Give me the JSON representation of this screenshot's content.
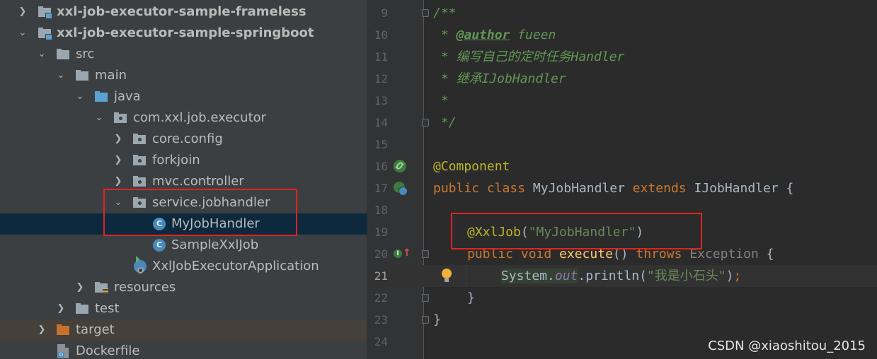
{
  "tree": {
    "items": [
      {
        "label": "xxl-job-executor-sample-frameless",
        "expanded": false
      },
      {
        "label": "xxl-job-executor-sample-springboot",
        "expanded": true
      },
      {
        "label": "src",
        "expanded": true
      },
      {
        "label": "main",
        "expanded": true
      },
      {
        "label": "java",
        "expanded": true
      },
      {
        "label": "com.xxl.job.executor",
        "expanded": true
      },
      {
        "label": "core.config",
        "expanded": false
      },
      {
        "label": "forkjoin",
        "expanded": false
      },
      {
        "label": "mvc.controller",
        "expanded": false
      },
      {
        "label": "service.jobhandler",
        "expanded": true
      },
      {
        "label": "MyJobHandler",
        "selected": true
      },
      {
        "label": "SampleXxlJob"
      },
      {
        "label": "XxlJobExecutorApplication"
      },
      {
        "label": "resources",
        "expanded": false
      },
      {
        "label": "test",
        "expanded": false
      },
      {
        "label": "target",
        "expanded": false
      },
      {
        "label": "Dockerfile"
      }
    ],
    "class_icon_letter": "C",
    "docker_icon_letter": "D"
  },
  "editor": {
    "line_numbers": [
      "9",
      "10",
      "11",
      "12",
      "13",
      "14",
      "15",
      "16",
      "17",
      "18",
      "19",
      "20",
      "21",
      "22",
      "23",
      "24"
    ],
    "current_line": "21",
    "code": {
      "l9": "/**",
      "l10_star": " * ",
      "l10_tag": "@author",
      "l10_rest": " fueen",
      "l11": " * 编写自己的定时任务Handler",
      "l12": " * 继承IJobHandler",
      "l13": " *",
      "l14": " */",
      "l16": "@Component",
      "l17_kw": "public class ",
      "l17_name": "MyJobHandler ",
      "l17_ext": "extends ",
      "l17_rest": "IJobHandler {",
      "l19_annot": "@XxlJob",
      "l19_p1": "(",
      "l19_str": "\"MyJobHandler\"",
      "l19_p2": ")",
      "l20_kw": "public void ",
      "l20_fn": "execute",
      "l20_p": "() ",
      "l20_throws": "throws ",
      "l20_exc": "Exception",
      "l20_brace": " {",
      "l21_sys": "System.",
      "l21_out": "out",
      "l21_call": ".println(",
      "l21_str": "\"我是小石头\"",
      "l21_close": ")",
      "l21_semi": ";",
      "l22": "}",
      "l23": "}"
    },
    "override_letter": "I",
    "override_arrow": "↑"
  },
  "colors": {
    "highlight_box": "#e0231f",
    "selection": "#0d293e",
    "comment": "#629755",
    "keyword": "#cc7832",
    "annotation": "#bbb529",
    "string": "#6a8759",
    "method": "#ffc66d"
  },
  "watermark": "CSDN @xiaoshitou_2015"
}
